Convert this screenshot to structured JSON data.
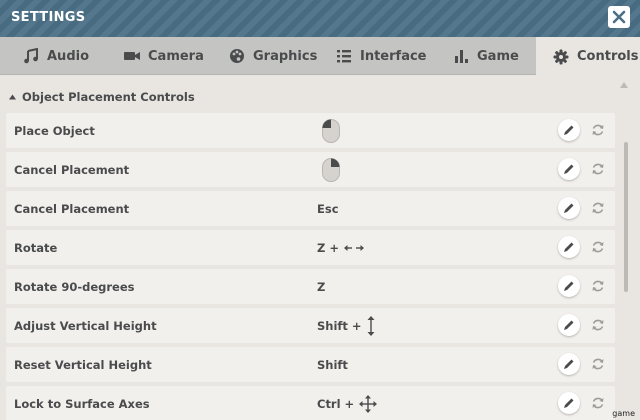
{
  "window": {
    "title": "SETTINGS"
  },
  "tabs": [
    {
      "label": "Audio",
      "icon": "music-note-icon"
    },
    {
      "label": "Camera",
      "icon": "video-camera-icon"
    },
    {
      "label": "Graphics",
      "icon": "palette-icon"
    },
    {
      "label": "Interface",
      "icon": "list-icon"
    },
    {
      "label": "Game",
      "icon": "bar-chart-icon"
    },
    {
      "label": "Controls",
      "icon": "gear-icon",
      "active": true
    }
  ],
  "section": {
    "title": "Object Placement Controls"
  },
  "rows": [
    {
      "label": "Place Object",
      "binding": "",
      "binding_icon": "mouse-left-click-icon"
    },
    {
      "label": "Cancel Placement",
      "binding": "",
      "binding_icon": "mouse-right-click-icon"
    },
    {
      "label": "Cancel Placement",
      "binding": "Esc",
      "binding_icon": ""
    },
    {
      "label": "Rotate",
      "binding": "Z +",
      "binding_icon": "left-right-arrows-icon"
    },
    {
      "label": "Rotate 90-degrees",
      "binding": "Z",
      "binding_icon": ""
    },
    {
      "label": "Adjust Vertical Height",
      "binding": "Shift +",
      "binding_icon": "up-down-arrow-icon"
    },
    {
      "label": "Reset Vertical Height",
      "binding": "Shift",
      "binding_icon": ""
    },
    {
      "label": "Lock to Surface Axes",
      "binding": "Ctrl +",
      "binding_icon": "move-arrows-icon"
    }
  ],
  "watermark": "game",
  "colors": {
    "titlebar": "#4a6f86",
    "tabbar": "#c4c4c2",
    "background": "#e9e6e2",
    "row": "#f2f0ec",
    "text": "#4a4b4d"
  }
}
